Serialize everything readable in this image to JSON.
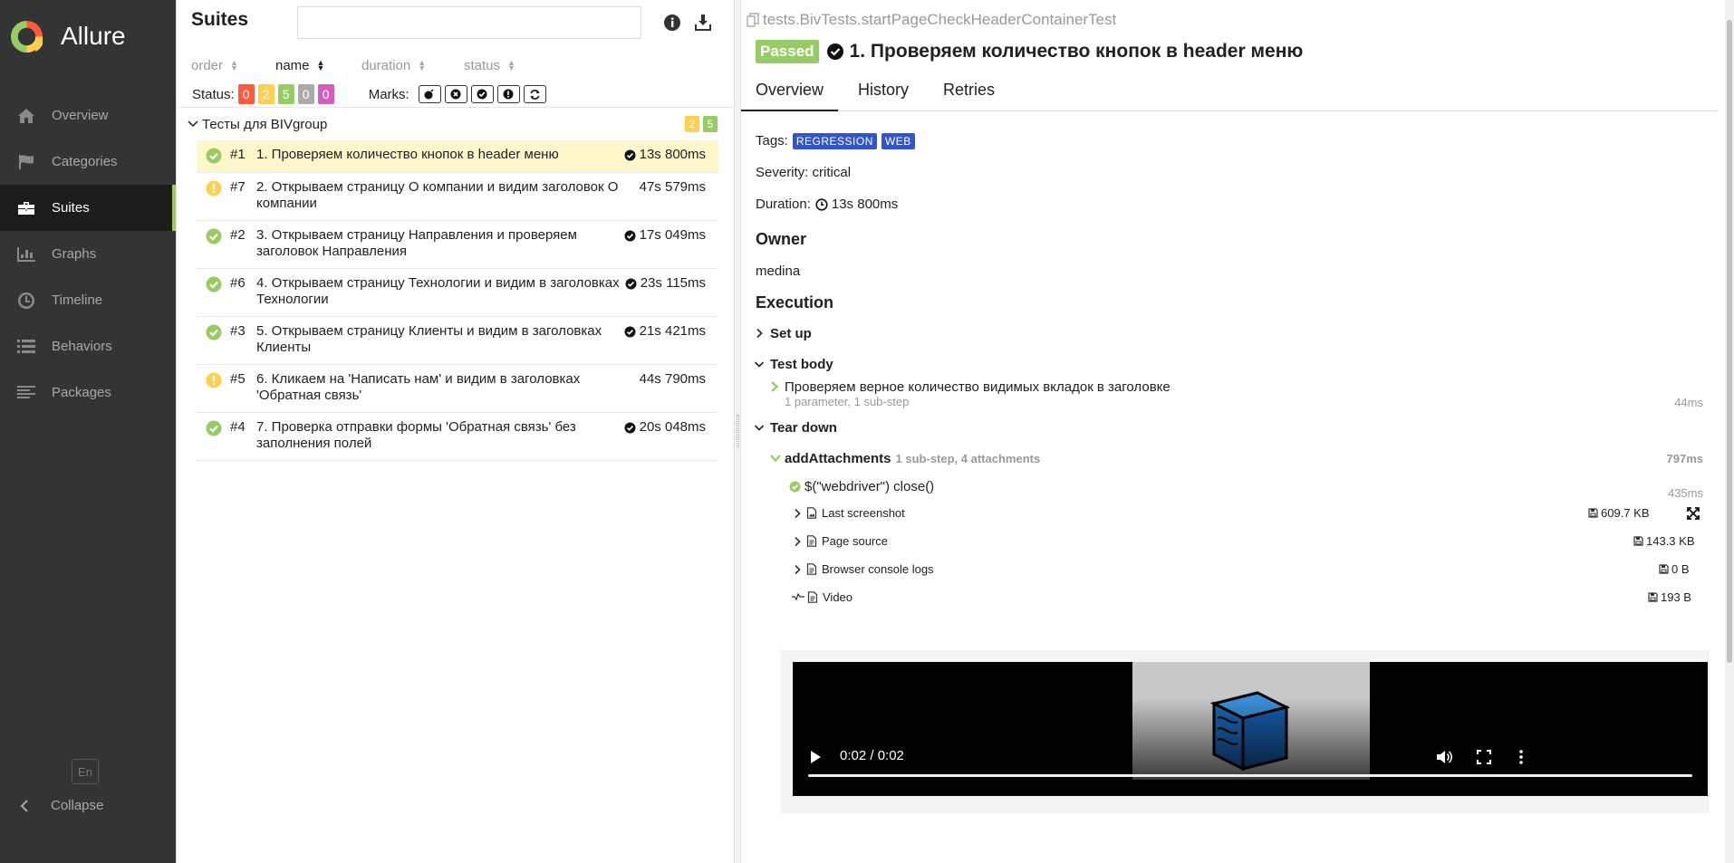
{
  "app": {
    "name": "Allure"
  },
  "sidebar": {
    "items": [
      {
        "label": "Overview",
        "icon": "home-icon"
      },
      {
        "label": "Categories",
        "icon": "flag-icon"
      },
      {
        "label": "Suites",
        "icon": "briefcase-icon",
        "active": true
      },
      {
        "label": "Graphs",
        "icon": "bar-chart-icon"
      },
      {
        "label": "Timeline",
        "icon": "clock-icon"
      },
      {
        "label": "Behaviors",
        "icon": "list-icon"
      },
      {
        "label": "Packages",
        "icon": "align-left-icon"
      }
    ],
    "language": "En",
    "collapse_label": "Collapse"
  },
  "suites": {
    "title": "Suites",
    "search": {
      "value": "",
      "placeholder": ""
    },
    "sort": [
      "order",
      "name",
      "duration",
      "status"
    ],
    "status_label": "Status:",
    "status_counts": [
      {
        "value": "0",
        "color": "#fd5a3e"
      },
      {
        "value": "2",
        "color": "#ffd050"
      },
      {
        "value": "5",
        "color": "#97cc64"
      },
      {
        "value": "0",
        "color": "#aaaaaa"
      },
      {
        "value": "0",
        "color": "#d35ebe"
      }
    ],
    "marks_label": "Marks:",
    "group": {
      "name": "Тесты для BIVgroup",
      "counts": [
        {
          "value": "2",
          "color": "#ffd050"
        },
        {
          "value": "5",
          "color": "#97cc64"
        }
      ]
    },
    "cases": [
      {
        "num": "#1",
        "name": "1. Проверяем количество кнопок в header меню",
        "duration": "13s 800ms",
        "status": "passed",
        "selected": true,
        "flaky_mark": true
      },
      {
        "num": "#7",
        "name": "2. Открываем страницу О компании и видим заголовок О компании",
        "duration": "47s 579ms",
        "status": "broken",
        "flaky_mark": false
      },
      {
        "num": "#2",
        "name": "3. Открываем страницу Направления и проверяем заголовок Направления",
        "duration": "17s 049ms",
        "status": "passed",
        "flaky_mark": true
      },
      {
        "num": "#6",
        "name": "4. Открываем страницу Технологии и видим в заголовках Технологии",
        "duration": "23s 115ms",
        "status": "passed",
        "flaky_mark": true
      },
      {
        "num": "#3",
        "name": "5. Открываем страницу Клиенты и видим в заголовках Клиенты",
        "duration": "21s 421ms",
        "status": "passed",
        "flaky_mark": true
      },
      {
        "num": "#5",
        "name": "6. Кликаем на 'Написать нам' и видим в заголовках 'Обратная связь'",
        "duration": "44s 790ms",
        "status": "broken",
        "flaky_mark": false
      },
      {
        "num": "#4",
        "name": "7. Проверка отправки формы 'Обратная связь' без заполнения полей",
        "duration": "20s 048ms",
        "status": "passed",
        "flaky_mark": true
      }
    ]
  },
  "result": {
    "fullname": "tests.BivTests.startPageCheckHeaderContainerTest",
    "status": "Passed",
    "title": "1. Проверяем количество кнопок в header меню",
    "tabs": [
      "Overview",
      "History",
      "Retries"
    ],
    "tags_label": "Tags:",
    "tags": [
      "REGRESSION",
      "WEB"
    ],
    "severity": "Severity: critical",
    "duration_label": "Duration:",
    "duration": "13s 800ms",
    "owner_heading": "Owner",
    "owner": "medina",
    "execution_heading": "Execution",
    "setup_label": "Set up",
    "body_label": "Test body",
    "body_step": {
      "name": "Проверяем верное количество видимых вкладок в заголовке",
      "sub": "1 parameter, 1 sub-step",
      "time": "44ms"
    },
    "teardown_label": "Tear down",
    "teardown_step": {
      "name": "addAttachments",
      "sub": "1 sub-step, 4 attachments",
      "time": "797ms"
    },
    "substep": {
      "name": "$(\"webdriver\") close()",
      "time": "435ms"
    },
    "attachments": [
      {
        "name": "Last screenshot",
        "size": "609.7 KB",
        "icon": "image-file-icon"
      },
      {
        "name": "Page source",
        "size": "143.3 KB",
        "icon": "file-icon"
      },
      {
        "name": "Browser console logs",
        "size": "0 B",
        "icon": "file-icon"
      },
      {
        "name": "Video",
        "size": "193 B",
        "icon": "video-file-icon",
        "expanded": true
      }
    ],
    "video_time": "0:02 / 0:02"
  },
  "colors": {
    "passed": "#97cc64",
    "broken": "#ffd050",
    "failed": "#fd5a3e",
    "skipped": "#aaaaaa",
    "unknown": "#d35ebe",
    "tag": "#3455c9",
    "sidebar": "#343434"
  }
}
